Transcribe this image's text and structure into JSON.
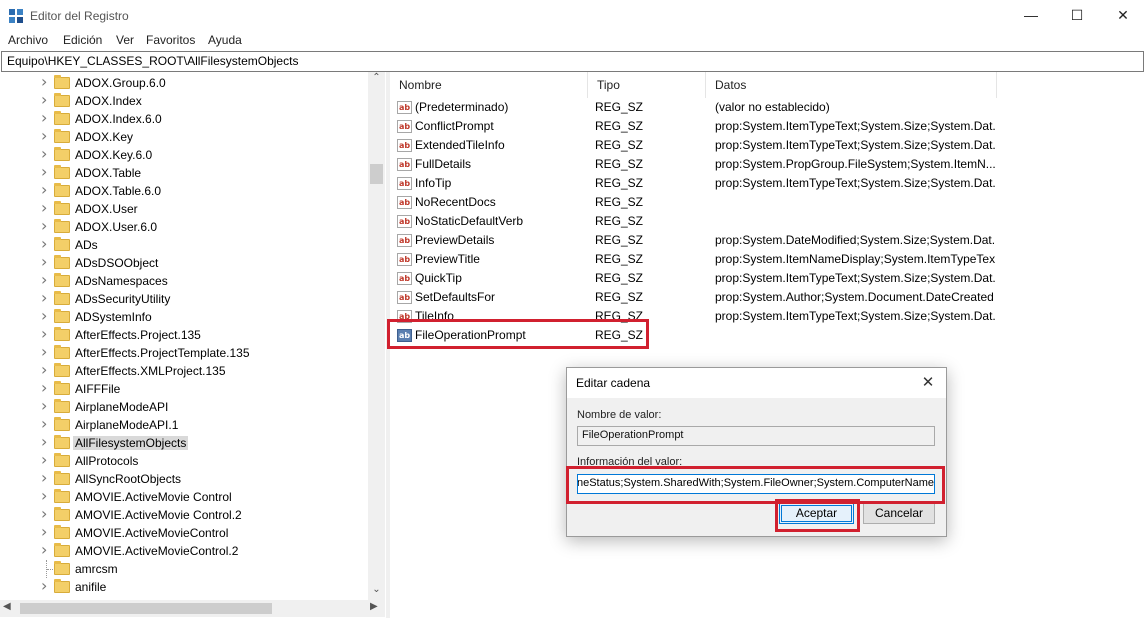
{
  "window": {
    "title": "Editor del Registro",
    "controls": {
      "minimize": "—",
      "maximize": "☐",
      "close": "✕"
    }
  },
  "menu": {
    "items": [
      "Archivo",
      "Edición",
      "Ver",
      "Favoritos",
      "Ayuda"
    ]
  },
  "address": "Equipo\\HKEY_CLASSES_ROOT\\AllFilesystemObjects",
  "tree": {
    "items": [
      {
        "label": "ADOX.Group.6.0",
        "expandable": true
      },
      {
        "label": "ADOX.Index",
        "expandable": true
      },
      {
        "label": "ADOX.Index.6.0",
        "expandable": true
      },
      {
        "label": "ADOX.Key",
        "expandable": true
      },
      {
        "label": "ADOX.Key.6.0",
        "expandable": true
      },
      {
        "label": "ADOX.Table",
        "expandable": true
      },
      {
        "label": "ADOX.Table.6.0",
        "expandable": true
      },
      {
        "label": "ADOX.User",
        "expandable": true
      },
      {
        "label": "ADOX.User.6.0",
        "expandable": true
      },
      {
        "label": "ADs",
        "expandable": true
      },
      {
        "label": "ADsDSOObject",
        "expandable": true
      },
      {
        "label": "ADsNamespaces",
        "expandable": true
      },
      {
        "label": "ADsSecurityUtility",
        "expandable": true
      },
      {
        "label": "ADSystemInfo",
        "expandable": true
      },
      {
        "label": "AfterEffects.Project.135",
        "expandable": true
      },
      {
        "label": "AfterEffects.ProjectTemplate.135",
        "expandable": true
      },
      {
        "label": "AfterEffects.XMLProject.135",
        "expandable": true
      },
      {
        "label": "AIFFFile",
        "expandable": true
      },
      {
        "label": "AirplaneModeAPI",
        "expandable": true
      },
      {
        "label": "AirplaneModeAPI.1",
        "expandable": true
      },
      {
        "label": "AllFilesystemObjects",
        "expandable": true,
        "selected": true
      },
      {
        "label": "AllProtocols",
        "expandable": true
      },
      {
        "label": "AllSyncRootObjects",
        "expandable": true
      },
      {
        "label": "AMOVIE.ActiveMovie Control",
        "expandable": true
      },
      {
        "label": "AMOVIE.ActiveMovie Control.2",
        "expandable": true
      },
      {
        "label": "AMOVIE.ActiveMovieControl",
        "expandable": true
      },
      {
        "label": "AMOVIE.ActiveMovieControl.2",
        "expandable": true
      },
      {
        "label": "amrcsm",
        "expandable": false
      },
      {
        "label": "anifile",
        "expandable": true
      }
    ]
  },
  "values": {
    "columns": [
      "Nombre",
      "Tipo",
      "Datos"
    ],
    "rows": [
      {
        "name": "(Predeterminado)",
        "type": "REG_SZ",
        "data": "(valor no establecido)",
        "icon": "ab"
      },
      {
        "name": "ConflictPrompt",
        "type": "REG_SZ",
        "data": "prop:System.ItemTypeText;System.Size;System.Dat...",
        "icon": "ab"
      },
      {
        "name": "ExtendedTileInfo",
        "type": "REG_SZ",
        "data": "prop:System.ItemTypeText;System.Size;System.Dat...",
        "icon": "ab"
      },
      {
        "name": "FullDetails",
        "type": "REG_SZ",
        "data": "prop:System.PropGroup.FileSystem;System.ItemN...",
        "icon": "ab"
      },
      {
        "name": "InfoTip",
        "type": "REG_SZ",
        "data": "prop:System.ItemTypeText;System.Size;System.Dat...",
        "icon": "ab"
      },
      {
        "name": "NoRecentDocs",
        "type": "REG_SZ",
        "data": "",
        "icon": "ab"
      },
      {
        "name": "NoStaticDefaultVerb",
        "type": "REG_SZ",
        "data": "",
        "icon": "ab"
      },
      {
        "name": "PreviewDetails",
        "type": "REG_SZ",
        "data": "prop:System.DateModified;System.Size;System.Dat...",
        "icon": "ab"
      },
      {
        "name": "PreviewTitle",
        "type": "REG_SZ",
        "data": "prop:System.ItemNameDisplay;System.ItemTypeText",
        "icon": "ab"
      },
      {
        "name": "QuickTip",
        "type": "REG_SZ",
        "data": "prop:System.ItemTypeText;System.Size;System.Dat...",
        "icon": "ab"
      },
      {
        "name": "SetDefaultsFor",
        "type": "REG_SZ",
        "data": "prop:System.Author;System.Document.DateCreated",
        "icon": "ab"
      },
      {
        "name": "TileInfo",
        "type": "REG_SZ",
        "data": "prop:System.ItemTypeText;System.Size;System.Dat...",
        "icon": "ab"
      },
      {
        "name": "FileOperationPrompt",
        "type": "REG_SZ",
        "data": "",
        "icon": "bin"
      }
    ]
  },
  "dialog": {
    "title": "Editar cadena",
    "close": "✕",
    "name_label": "Nombre de valor:",
    "name_value": "FileOperationPrompt",
    "data_label": "Información del valor:",
    "data_value": "OfflineStatus;System.SharedWith;System.FileOwner;System.ComputerName",
    "ok": "Aceptar",
    "cancel": "Cancelar"
  },
  "colors": {
    "highlight": "#d1202f",
    "accent": "#0078d7",
    "folder": "#f3cf68"
  }
}
